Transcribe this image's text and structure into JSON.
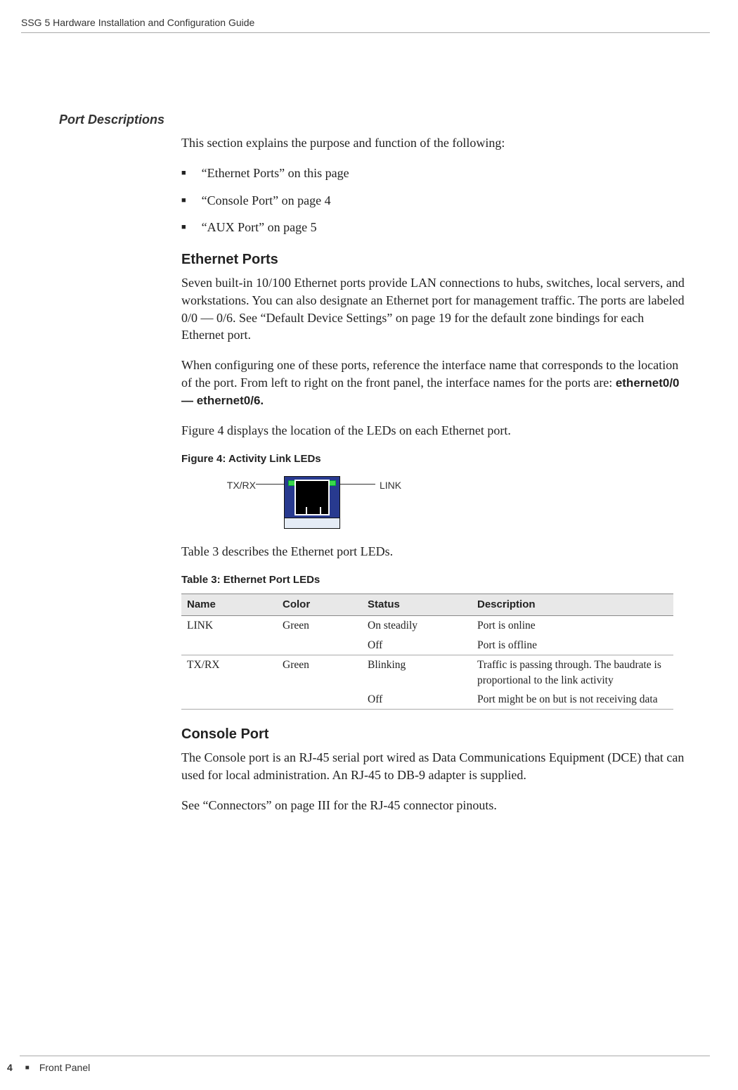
{
  "header": {
    "title": "SSG 5 Hardware Installation and Configuration Guide"
  },
  "section": {
    "heading": "Port Descriptions"
  },
  "intro": "This section explains the purpose and function of the following:",
  "bullets": [
    "“Ethernet Ports” on this page",
    "“Console Port” on page 4",
    "“AUX Port” on page 5"
  ],
  "ethernet": {
    "heading": "Ethernet Ports",
    "p1": "Seven built-in 10/100 Ethernet ports provide LAN connections to hubs, switches, local servers, and workstations. You can also designate an Ethernet port for management traffic. The ports are labeled 0/0 — 0/6. See “Default Device Settings” on page 19 for the default zone bindings for each Ethernet port.",
    "p2_pre": "When configuring one of these ports, reference the interface name that corresponds to the location of the port. From left to right on the front panel, the interface names for the ports are: ",
    "p2_bold": "ethernet0/0 — ethernet0/6.",
    "p3": "Figure 4 displays the location of the LEDs on each Ethernet port.",
    "fig_caption": "Figure 4:  Activity Link LEDs",
    "fig_left": "TX/RX",
    "fig_right": "LINK",
    "p4": "Table 3 describes the Ethernet port LEDs.",
    "table_caption": "Table 3:  Ethernet Port LEDs"
  },
  "table": {
    "headers": [
      "Name",
      "Color",
      "Status",
      "Description"
    ],
    "rows": [
      {
        "name": "LINK",
        "color": "Green",
        "status1": "On steadily",
        "desc1": "Port is online",
        "status2": "Off",
        "desc2": "Port is offline"
      },
      {
        "name": "TX/RX",
        "color": "Green",
        "status1": "Blinking",
        "desc1": "Traffic is passing through. The baudrate is proportional to the link activity",
        "status2": "Off",
        "desc2": "Port might be on but is not receiving data"
      }
    ]
  },
  "console": {
    "heading": "Console Port",
    "p1": "The Console port is an RJ-45 serial port wired as Data Communications Equipment (DCE) that can used for local administration. An RJ-45 to DB-9 adapter is supplied.",
    "p2": "See “Connectors” on page III for the RJ-45 connector pinouts."
  },
  "footer": {
    "page": "4",
    "section": "Front Panel"
  }
}
